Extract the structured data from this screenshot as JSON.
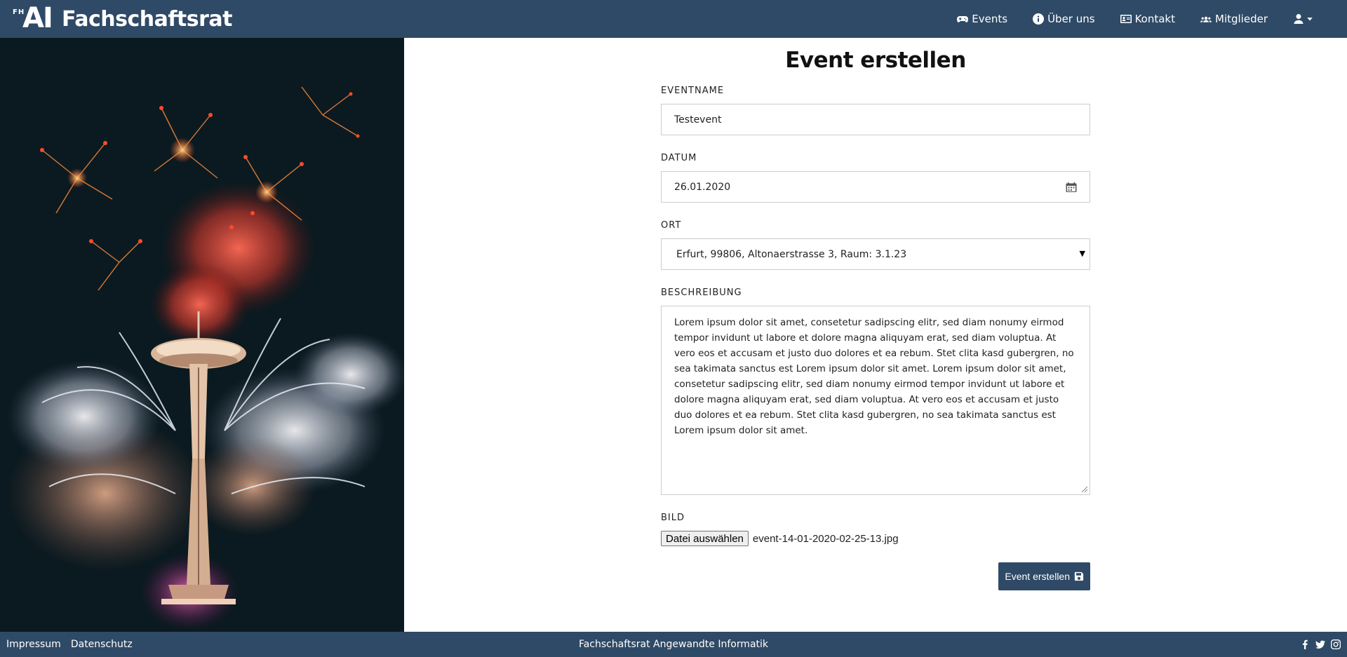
{
  "navbar": {
    "brand_logo_small": "FH",
    "brand_logo_big": "AI",
    "brand_name": "Fachschaftsrat",
    "items": [
      {
        "label": "Events",
        "icon": "gamepad-icon"
      },
      {
        "label": "Über uns",
        "icon": "info-circle-icon"
      },
      {
        "label": "Kontakt",
        "icon": "address-card-icon"
      },
      {
        "label": "Mitglieder",
        "icon": "users-icon"
      }
    ],
    "user_menu_icon": "user-icon"
  },
  "hero": {
    "image": "fireworks-space-needle"
  },
  "form": {
    "title": "Event erstellen",
    "eventname": {
      "label": "EVENTNAME",
      "value": "Testevent"
    },
    "datum": {
      "label": "DATUM",
      "value": "26.01.2020",
      "icon": "calendar-icon"
    },
    "ort": {
      "label": "ORT",
      "selected": "Erfurt, 99806, Altonaerstrasse 3, Raum: 3.1.23"
    },
    "beschreibung": {
      "label": "BESCHREIBUNG",
      "value": "Lorem ipsum dolor sit amet, consetetur sadipscing elitr, sed diam nonumy eirmod tempor invidunt ut labore et dolore magna aliquyam erat, sed diam voluptua. At vero eos et accusam et justo duo dolores et ea rebum. Stet clita kasd gubergren, no sea takimata sanctus est Lorem ipsum dolor sit amet. Lorem ipsum dolor sit amet, consetetur sadipscing elitr, sed diam nonumy eirmod tempor invidunt ut labore et dolore magna aliquyam erat, sed diam voluptua. At vero eos et accusam et justo duo dolores et ea rebum. Stet clita kasd gubergren, no sea takimata sanctus est Lorem ipsum dolor sit amet."
    },
    "bild": {
      "label": "BILD",
      "button_label": "Datei auswählen",
      "file_name": "event-14-01-2020-02-25-13.jpg"
    },
    "submit_label": "Event erstellen",
    "submit_icon": "save-icon"
  },
  "footer": {
    "links": [
      "Impressum",
      "Datenschutz"
    ],
    "center_text": "Fachschaftsrat Angewandte Informatik",
    "social": [
      "facebook-icon",
      "twitter-icon",
      "instagram-icon"
    ]
  },
  "colors": {
    "navbar_bg": "#2f4a66",
    "button_bg": "#2f4a66"
  }
}
